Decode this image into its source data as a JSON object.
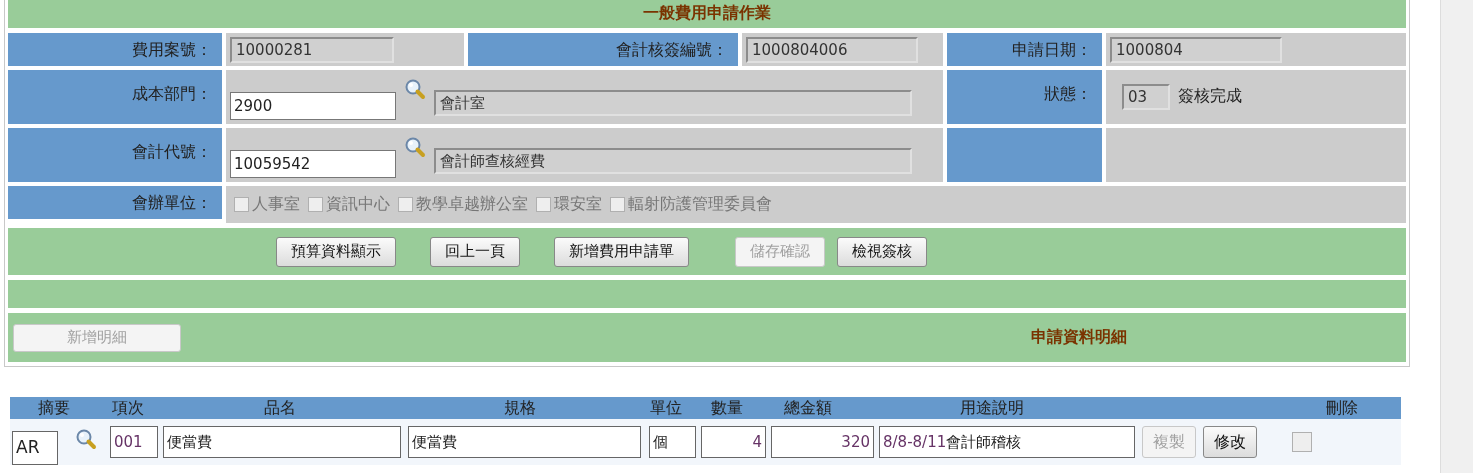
{
  "title": "一般費用申請作業",
  "fields": {
    "expense_no": {
      "label": "費用案號：",
      "value": "10000281"
    },
    "approval_no": {
      "label": "會計核簽編號：",
      "value": "1000804006"
    },
    "apply_date": {
      "label": "申請日期：",
      "value": "1000804"
    },
    "cost_dept": {
      "label": "成本部門：",
      "code": "2900",
      "name": "會計室"
    },
    "status": {
      "label": "狀態：",
      "code": "03",
      "text": "簽核完成"
    },
    "account": {
      "label": "會計代號：",
      "code": "10059542",
      "name": "會計師查核經費"
    }
  },
  "co_units": {
    "label": "會辦單位：",
    "options": [
      {
        "label": "人事室",
        "checked": false,
        "disabled": true
      },
      {
        "label": "資訊中心",
        "checked": false,
        "disabled": true
      },
      {
        "label": "教學卓越辦公室",
        "checked": false,
        "disabled": true
      },
      {
        "label": "環安室",
        "checked": false,
        "disabled": true
      },
      {
        "label": "輻射防護管理委員會",
        "checked": false,
        "disabled": true
      }
    ]
  },
  "buttons": [
    {
      "label": "預算資料顯示",
      "disabled": false
    },
    {
      "label": "回上一頁",
      "disabled": false
    },
    {
      "label": "新增費用申請單",
      "disabled": false
    },
    {
      "label": "儲存確認",
      "disabled": true
    },
    {
      "label": "檢視簽核",
      "disabled": false
    }
  ],
  "add_detail_button": {
    "label": "新增明細",
    "disabled": true
  },
  "detail_title": "申請資料明細",
  "table": {
    "columns": [
      "摘要",
      "項次",
      "品名",
      "規格",
      "單位",
      "數量",
      "總金額",
      "用途說明",
      "刪除"
    ],
    "rows": [
      {
        "summary": "AR",
        "item": "001",
        "name": "便當費",
        "spec": "便當費",
        "unit": "個",
        "qty": "4",
        "total": "320",
        "purpose_date": "8/8-8/11",
        "purpose": "會計師稽核",
        "copy": {
          "label": "複製",
          "disabled": true
        },
        "edit": {
          "label": "修改",
          "disabled": false
        },
        "delete_checked": false
      }
    ]
  }
}
